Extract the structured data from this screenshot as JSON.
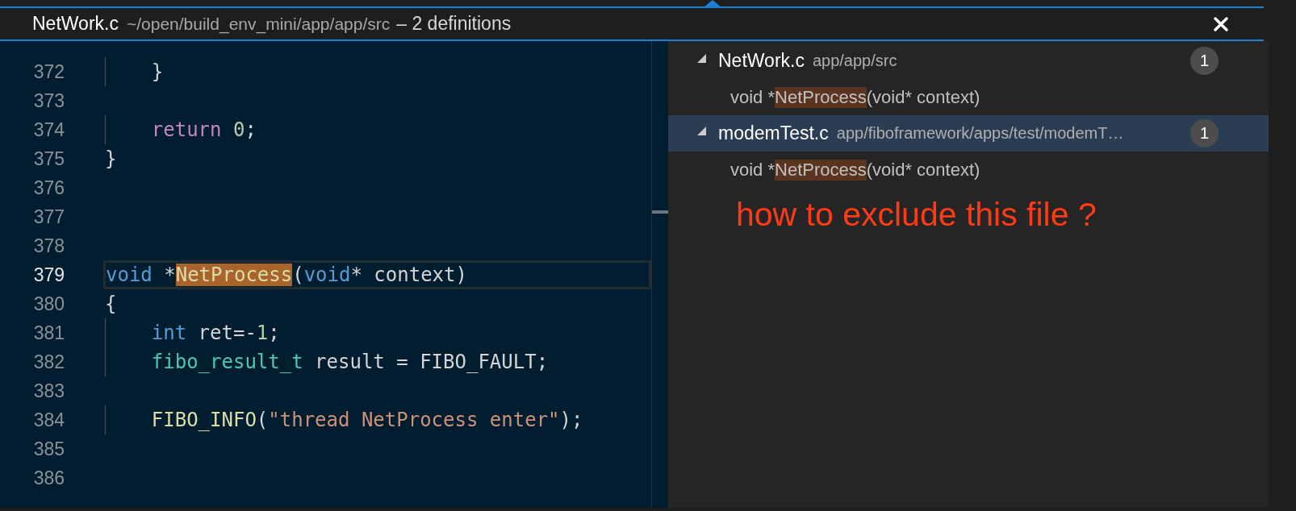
{
  "header": {
    "file": "NetWork.c",
    "path": "~/open/build_env_mini/app/app/src",
    "summary": "– 2 definitions"
  },
  "editor": {
    "lines": [
      {
        "number": "372",
        "current": false,
        "tokens": [
          {
            "kind": "plain",
            "text": "    }"
          }
        ]
      },
      {
        "number": "373",
        "current": false
      },
      {
        "number": "374",
        "current": false,
        "tokens": [
          {
            "kind": "keyword",
            "text": "    return"
          },
          {
            "kind": "number",
            "text": " 0"
          },
          {
            "kind": "plain",
            "text": ";"
          }
        ]
      },
      {
        "number": "375",
        "current": false,
        "tokens": [
          {
            "kind": "plain",
            "text": "}"
          }
        ]
      },
      {
        "number": "376",
        "current": false
      },
      {
        "number": "377",
        "current": false
      },
      {
        "number": "378",
        "current": false
      },
      {
        "number": "379",
        "current": true,
        "tokens": [
          {
            "kind": "type",
            "text": "void"
          },
          {
            "kind": "plain",
            "text": " *"
          },
          {
            "kind": "match",
            "text": "NetProcess"
          },
          {
            "kind": "plain",
            "text": "("
          },
          {
            "kind": "type",
            "text": "void"
          },
          {
            "kind": "plain",
            "text": "* context)"
          }
        ]
      },
      {
        "number": "380",
        "current": false,
        "tokens": [
          {
            "kind": "plain",
            "text": "{"
          }
        ]
      },
      {
        "number": "381",
        "current": false,
        "tokens": [
          {
            "kind": "type",
            "text": "    int"
          },
          {
            "kind": "plain",
            "text": " ret=-"
          },
          {
            "kind": "number",
            "text": "1"
          },
          {
            "kind": "plain",
            "text": ";"
          }
        ]
      },
      {
        "number": "382",
        "current": false,
        "tokens": [
          {
            "kind": "typename",
            "text": "    fibo_result_t"
          },
          {
            "kind": "plain",
            "text": " result = FIBO_FAULT;"
          }
        ]
      },
      {
        "number": "383",
        "current": false
      },
      {
        "number": "384",
        "current": false,
        "tokens": [
          {
            "kind": "function",
            "text": "    FIBO_INFO"
          },
          {
            "kind": "plain",
            "text": "("
          },
          {
            "kind": "string",
            "text": "\"thread NetProcess enter\""
          },
          {
            "kind": "plain",
            "text": ");"
          }
        ]
      },
      {
        "number": "385",
        "current": false
      },
      {
        "number": "386",
        "current": false
      }
    ]
  },
  "results": [
    {
      "file": "NetWork.c",
      "path": "app/app/src",
      "count": "1",
      "expanded": true,
      "selected": false,
      "matches": [
        {
          "parts": [
            {
              "text": "void *",
              "match": false
            },
            {
              "text": "NetProcess",
              "match": true
            },
            {
              "text": "(void* context)",
              "match": false
            }
          ]
        }
      ]
    },
    {
      "file": "modemTest.c",
      "path": "app/fiboframework/apps/test/modemT…",
      "count": "1",
      "expanded": true,
      "selected": true,
      "matches": [
        {
          "parts": [
            {
              "text": "void *",
              "match": false
            },
            {
              "text": "NetProcess",
              "match": true
            },
            {
              "text": "(void* context)",
              "match": false
            }
          ]
        }
      ]
    }
  ],
  "annotation": {
    "text": "how to exclude this file ?"
  }
}
